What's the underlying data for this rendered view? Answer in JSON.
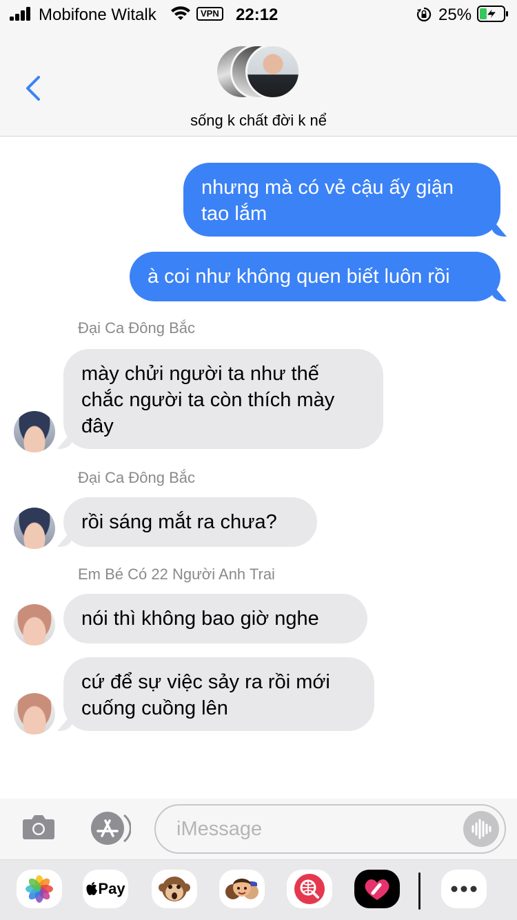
{
  "status_bar": {
    "carrier": "Mobifone Witalk",
    "vpn": "VPN",
    "time": "22:12",
    "battery": "25%"
  },
  "header": {
    "title": "sống k chất đời k nể"
  },
  "messages": [
    {
      "dir": "out",
      "text": "nhưng mà có vẻ cậu ấy giận tao lắm"
    },
    {
      "dir": "out",
      "text": "à coi như không quen biết luôn rồi"
    },
    {
      "dir": "in",
      "sender": "Đại Ca Đông Bắc",
      "text": "mày chửi người ta như thế chắc người ta còn thích mày đây"
    },
    {
      "dir": "in",
      "sender": "Đại Ca Đông Bắc",
      "text": "rồi sáng mắt ra chưa?"
    },
    {
      "dir": "in",
      "sender": "Em Bé Có 22 Người Anh Trai",
      "text": "nói thì không bao giờ nghe"
    },
    {
      "dir": "in",
      "text": "cứ để sự việc sảy ra rồi mới cuống cuồng lên"
    }
  ],
  "input": {
    "placeholder": "iMessage"
  },
  "app_strip": {
    "apple_pay": "Pay"
  }
}
